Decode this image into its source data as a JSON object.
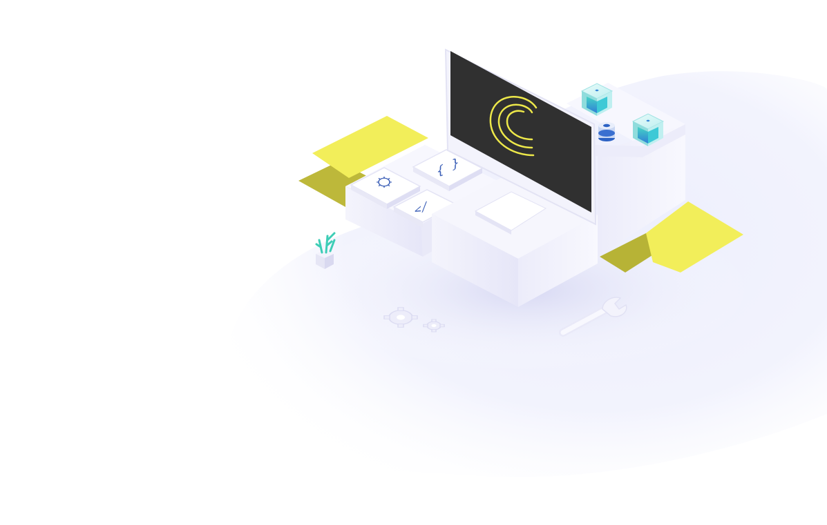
{
  "scene": {
    "background": "#ffffff",
    "colors": {
      "accent_yellow": "#f2ee5a",
      "accent_yellow_dark": "#b9b53a",
      "screen_dark": "#303030",
      "logo_yellow": "#ede84a",
      "platform_white": "#f6f6fd",
      "platform_shadow": "#dcdcf3",
      "blob_lavender": "#eef0fd",
      "cube_teal": "#3dd0c3",
      "cube_blue": "#3b73d6"
    },
    "icons": [
      "monitor-icon",
      "logo-c-icon",
      "gear-icon",
      "curly-braces-icon",
      "code-tag-icon",
      "server-cube-icon",
      "database-icon",
      "plant-icon",
      "gears-icon",
      "wrench-icon"
    ]
  }
}
